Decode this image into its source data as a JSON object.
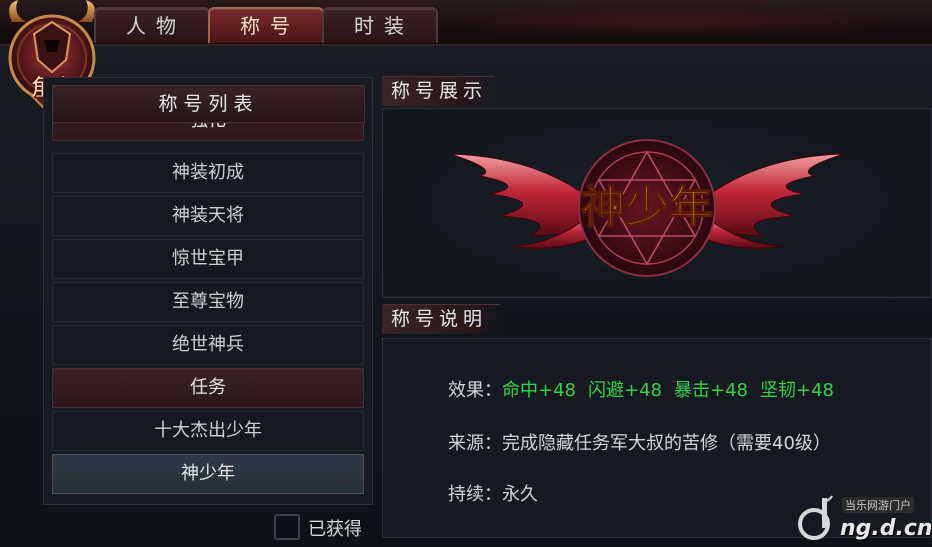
{
  "emblem": {
    "label": "角色"
  },
  "tabs": [
    {
      "label": "人物",
      "active": false
    },
    {
      "label": "称号",
      "active": true
    },
    {
      "label": "时装",
      "active": false
    }
  ],
  "title_list": {
    "header": "称号列表",
    "rows": [
      {
        "label": "强化",
        "type": "category"
      },
      {
        "label": "神装初成",
        "type": "item"
      },
      {
        "label": "神装天将",
        "type": "item"
      },
      {
        "label": "惊世宝甲",
        "type": "item"
      },
      {
        "label": "至尊宝物",
        "type": "item"
      },
      {
        "label": "绝世神兵",
        "type": "item"
      },
      {
        "label": "任务",
        "type": "category"
      },
      {
        "label": "十大杰出少年",
        "type": "item"
      },
      {
        "label": "神少年",
        "type": "selected"
      }
    ]
  },
  "obtained_filter": {
    "label": "已获得",
    "checked": false
  },
  "display": {
    "header": "称号展示",
    "title_art_text": "神少年"
  },
  "description": {
    "header": "称号说明",
    "effect_label": "效果：",
    "effects": [
      "命中+48",
      "闪避+48",
      "暴击+48",
      "坚韧+48"
    ],
    "source_label": "来源：",
    "source_value": "完成隐藏任务军大叔的苦修（需要40级）",
    "duration_label": "持续：",
    "duration_value": "永久"
  },
  "watermark": {
    "small": "当乐网游门户",
    "big": "ng.d.cn"
  },
  "colors": {
    "accent": "#7a2a2c",
    "effect_green": "#34d24a",
    "panel_bg": "#161a20"
  }
}
